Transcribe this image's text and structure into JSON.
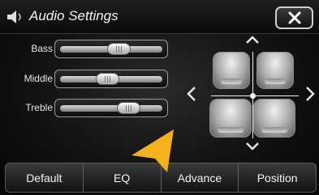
{
  "header": {
    "title": "Audio Settings",
    "icon": "speaker-icon",
    "close_icon": "close-icon"
  },
  "sliders": [
    {
      "label": "Bass",
      "level": 0.6
    },
    {
      "label": "Middle",
      "level": 0.45
    },
    {
      "label": "Treble",
      "level": 0.72
    }
  ],
  "balance": {
    "arrows": [
      "chevron-up-icon",
      "chevron-down-icon",
      "chevron-left-icon",
      "chevron-right-icon"
    ],
    "seats": [
      "front-left-seat",
      "front-right-seat",
      "rear-left-seat",
      "rear-right-seat"
    ]
  },
  "tabs": [
    "Default",
    "EQ",
    "Advance",
    "Position"
  ],
  "colors": {
    "pointer": "#f4b11c",
    "accent": "#ffffff"
  }
}
